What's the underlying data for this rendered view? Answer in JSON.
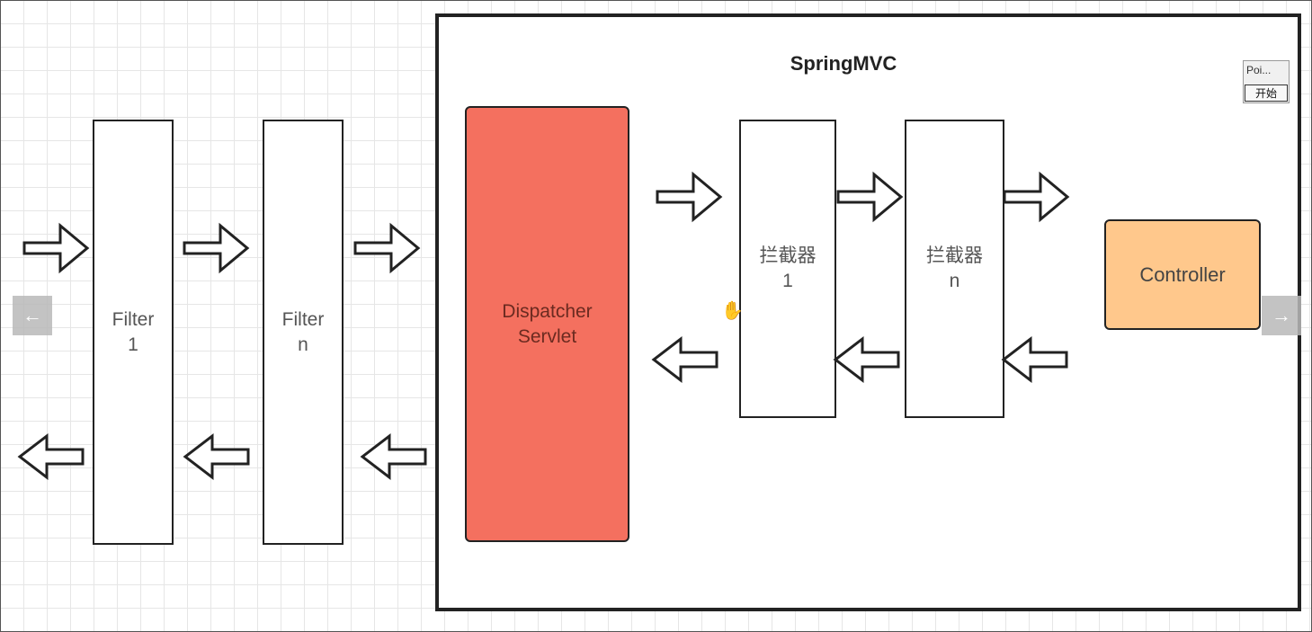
{
  "diagram": {
    "container_title": "SpringMVC",
    "filter_1": [
      "Filter",
      "1"
    ],
    "filter_n": [
      "Filter",
      "n"
    ],
    "dispatcher": [
      "Dispatcher",
      "Servlet"
    ],
    "interceptor_1": [
      "拦截器",
      "1"
    ],
    "interceptor_n": [
      "拦截器",
      "n"
    ],
    "controller": "Controller"
  },
  "colors": {
    "dispatcher_fill": "#f4705f",
    "controller_fill": "#ffc88c"
  },
  "overlay": {
    "pointer_label": "Poi...",
    "start_button": "开始"
  },
  "nav": {
    "prev_icon": "arrow-left-icon",
    "next_icon": "arrow-right-icon"
  }
}
